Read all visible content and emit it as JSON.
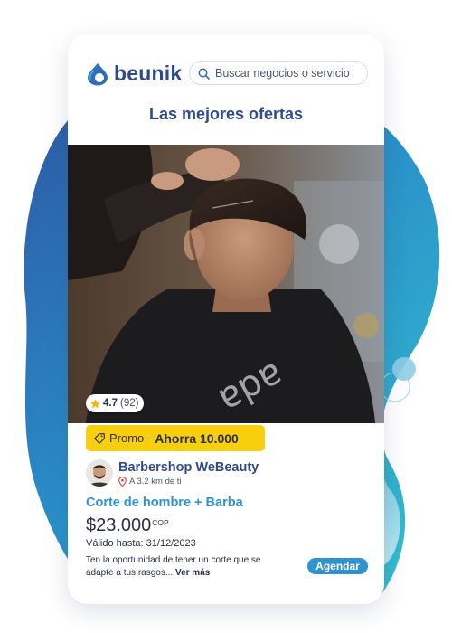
{
  "brand": {
    "name": "beunik"
  },
  "search": {
    "placeholder": "Buscar negocios o servicio"
  },
  "section": {
    "title": "Las mejores ofertas"
  },
  "offer": {
    "rating": "4.7",
    "reviews": "(92)",
    "promo_label": "Promo -",
    "promo_saving": "Ahorra 10.000",
    "business_name": "Barbershop WeBeauty",
    "distance": "A 3.2 km de ti",
    "service": "Corte de hombre + Barba",
    "price": "$23.000",
    "currency": "COP",
    "valid_until": "Válido hasta: 31/12/2023",
    "description": "Ten la oportunidad de tener un corte que se adapte a tus rasgos...",
    "more_label": "Ver más",
    "cta_label": "Agendar"
  },
  "icons": {
    "logo": "beunik-logo-icon",
    "search": "search-icon",
    "star": "star-icon",
    "tag": "tag-icon",
    "location": "location-pin-icon"
  },
  "colors": {
    "brand_blue": "#2f4a8d",
    "accent_blue": "#2f93cf",
    "promo_yellow": "#f7cf0c",
    "blob_teal": "#2bb5c8"
  }
}
